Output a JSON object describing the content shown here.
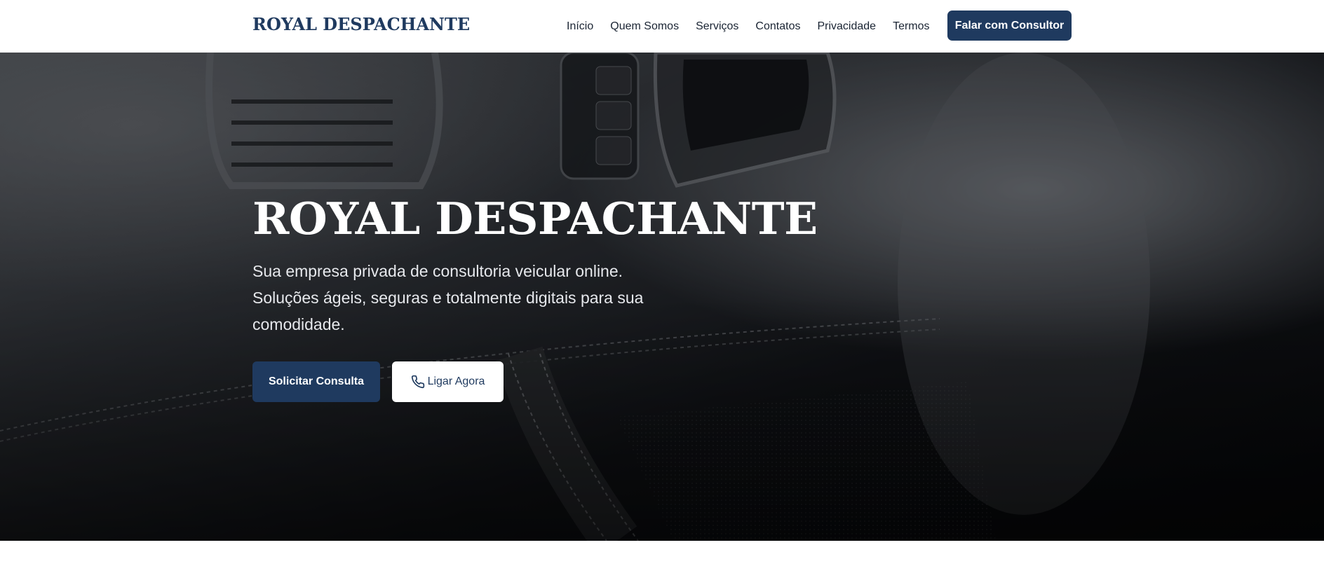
{
  "header": {
    "brand": "ROYAL DESPACHANTE",
    "nav": [
      {
        "label": "Início"
      },
      {
        "label": "Quem Somos"
      },
      {
        "label": "Serviços"
      },
      {
        "label": "Contatos"
      },
      {
        "label": "Privacidade"
      },
      {
        "label": "Termos"
      }
    ],
    "cta_label": "Falar com Consultor"
  },
  "hero": {
    "title": "ROYAL DESPACHANTE",
    "subtitle_lines": [
      "Sua empresa privada de consultoria veicular online.",
      "Soluções ágeis, seguras e totalmente digitais para sua",
      "comodidade."
    ],
    "primary_button": "Solicitar Consulta",
    "secondary_button": "Ligar Agora",
    "secondary_button_icon": "phone-icon"
  },
  "colors": {
    "brand_navy": "#1f3a5f",
    "header_bg": "#ffffff",
    "hero_overlay": "#0a0c10",
    "text_light": "#ffffff"
  }
}
